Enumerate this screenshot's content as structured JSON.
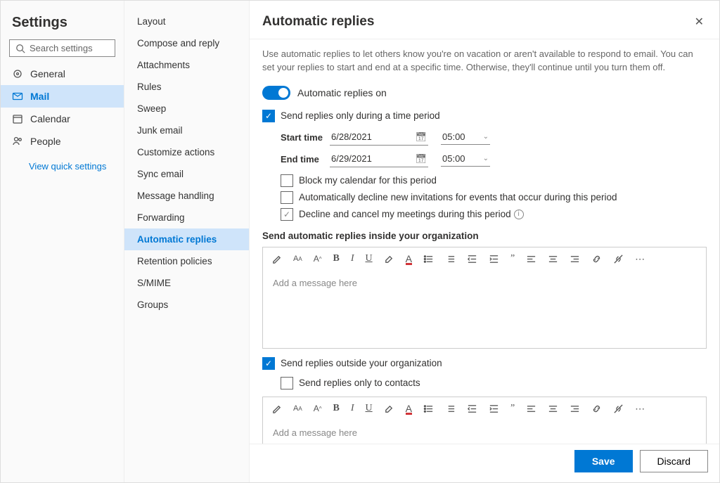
{
  "left": {
    "title": "Settings",
    "search_placeholder": "Search settings",
    "nav": [
      {
        "icon": "gear",
        "label": "General"
      },
      {
        "icon": "mail",
        "label": "Mail"
      },
      {
        "icon": "calendar",
        "label": "Calendar"
      },
      {
        "icon": "people",
        "label": "People"
      }
    ],
    "active_nav": 1,
    "quick_link": "View quick settings"
  },
  "mid": {
    "items": [
      "Layout",
      "Compose and reply",
      "Attachments",
      "Rules",
      "Sweep",
      "Junk email",
      "Customize actions",
      "Sync email",
      "Message handling",
      "Forwarding",
      "Automatic replies",
      "Retention policies",
      "S/MIME",
      "Groups"
    ],
    "active": 10
  },
  "main": {
    "title": "Automatic replies",
    "help": "Use automatic replies to let others know you're on vacation or aren't available to respond to email. You can set your replies to start and end at a specific time. Otherwise, they'll continue until you turn them off.",
    "toggle_on": true,
    "toggle_label": "Automatic replies on",
    "period_check": true,
    "period_label": "Send replies only during a time period",
    "start_label": "Start time",
    "start_date": "6/28/2021",
    "start_time": "05:00",
    "end_label": "End time",
    "end_date": "6/29/2021",
    "end_time": "05:00",
    "sub_checks": [
      {
        "checked": false,
        "gray": false,
        "label": "Block my calendar for this period"
      },
      {
        "checked": false,
        "gray": false,
        "label": "Automatically decline new invitations for events that occur during this period"
      },
      {
        "checked": false,
        "gray": true,
        "label": "Decline and cancel my meetings during this period"
      }
    ],
    "inside_label": "Send automatic replies inside your organization",
    "inside_placeholder": "Add a message here",
    "outside_check": true,
    "outside_label": "Send replies outside your organization",
    "contacts_check": false,
    "contacts_label": "Send replies only to contacts",
    "outside_placeholder": "Add a message here",
    "save": "Save",
    "discard": "Discard"
  }
}
